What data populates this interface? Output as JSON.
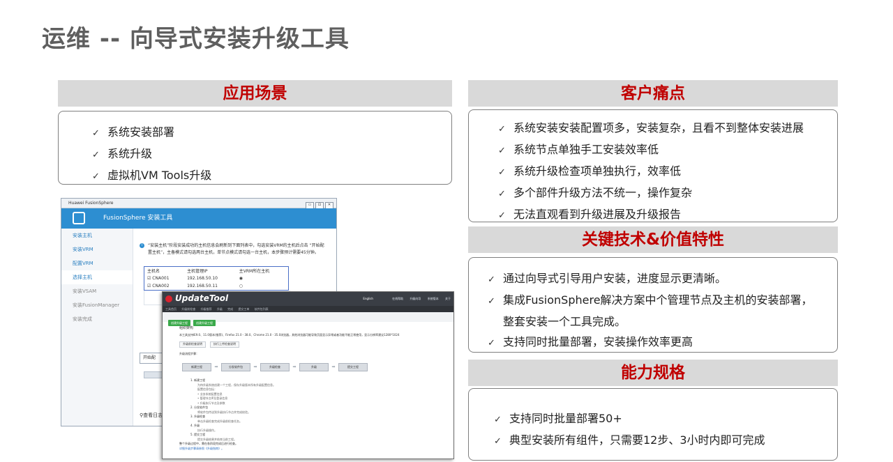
{
  "page_title": "运维 -- 向导式安装升级工具",
  "sections": {
    "scenario": {
      "heading": "应用场景",
      "items": [
        "系统安装部署",
        "系统升级",
        "虚拟机VM Tools升级"
      ]
    },
    "pain_points": {
      "heading": "客户痛点",
      "items": [
        "系统安装安装配置项多，安装复杂，且看不到整体安装进展",
        "系统节点单独手工安装效率低",
        "系统升级检查项单独执行，效率低",
        "多个部件升级方法不统一，操作复杂",
        "无法直观看到升级进展及升级报告"
      ]
    },
    "key_tech": {
      "heading": "关键技术&价值特性",
      "items": [
        "通过向导式引导用户安装，进度显示更清晰。",
        "集成FusionSphere解决方案中个管理节点及主机的安装部署，",
        "支持同时批量部署，安装操作效率更高"
      ],
      "item2_continuation": "整套安装一个工具完成。"
    },
    "capability": {
      "heading": "能力规格",
      "items": [
        "支持同时批量部署50+",
        "典型安装所有组件，只需要12步、3小时内即可完成"
      ]
    }
  },
  "check_glyph": "✓",
  "installer_window": {
    "window_title": "Huawei FusionSphere",
    "window_buttons": [
      "▭",
      "⊡",
      "✕"
    ],
    "header_title": "FusionSphere 安装工具",
    "steps": [
      "安装主机",
      "安装VRM",
      "配置VRM",
      "选择主机",
      "安装VSAM",
      "安装FusionManager",
      "安装完成"
    ],
    "info_text": "“安装主机”阶段安装成功的主机信息会刷新到下面列表中，勾选安装VRM的主机后点击 “开始配置主机”，主备模式请勾选两台主机，单节点模式请勾选一台主机，本步骤预计需要45分钟。",
    "table_headers": [
      "主机名",
      "主机管理IP",
      "主VRM所在主机"
    ],
    "table_rows": [
      {
        "name": "CNA001",
        "ip": "192.168.50.10"
      },
      {
        "name": "CNA002",
        "ip": "192.168.50.11"
      }
    ],
    "start_button": "开始配",
    "search_label": "查看日志"
  },
  "updatetool_window": {
    "brand": "UpdateTool",
    "header_links": [
      "English",
      "在线帮助",
      "升级向导",
      "系统版本",
      "关于"
    ],
    "nav_items": [
      "工具首页",
      "升级前检查",
      "升级推荐",
      "升级",
      "完成",
      "提交工单",
      "软件包列表"
    ],
    "tabs": [
      "创建升级工程",
      "创建升级工程"
    ],
    "welcome": "组织架构",
    "browser_note": "本工具支持IE9.0、11.0版本(推荐)、Firefox 21.0 - 38.0、Chrome 21.0 - 35.0浏览器，其他浏览器可能导致页面显示异常或者功能不能正常使用，显示分辨率建议1280*1024",
    "mini_buttons": [
      "升级前检查说明",
      "执行上传检查说明"
    ],
    "flow_label": "升级流程步骤：",
    "flow_steps": [
      "新建工程",
      "分发软件包",
      "升级检查",
      "升级",
      "提交工程"
    ],
    "steps_detail": [
      "1. 新建工程",
      "为待升级系统创建一个工程，保存升级版本所有升级配置信息。",
      "配置信息包括：",
      "• 业务系统配置信息",
      "• 管理节点IP及登录信息",
      "• 升级执行节点及参数",
      "2. 分发软件包",
      "将软件包传送到升级执行节点并完成校验。",
      "3. 升级检查",
      "单击升级检查完成升级前检查任务。",
      "4. 升级",
      "执行升级操作。",
      "5. 提交工程",
      "提交升级结果并结束当前工程。"
    ],
    "footer_line": "整个升级过程中，需在各阶段完成后进行检查。",
    "footer_link": "详细升级步骤请参照《升级指南》。"
  }
}
